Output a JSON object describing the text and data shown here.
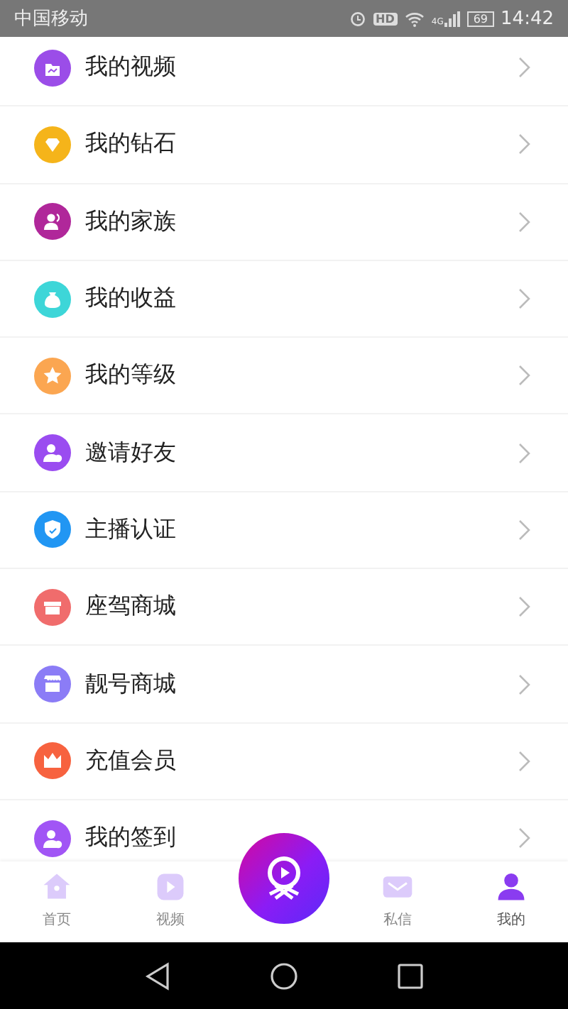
{
  "status_bar": {
    "carrier": "中国移动",
    "hd_badge": "HD",
    "network": "4G",
    "battery": "69",
    "time": "14:42"
  },
  "menu": [
    {
      "label": "我的视频",
      "kind": "video"
    },
    {
      "label": "我的钻石",
      "kind": "diamond"
    },
    {
      "label": "我的家族",
      "kind": "family"
    },
    {
      "label": "我的收益",
      "kind": "income"
    },
    {
      "label": "我的等级",
      "kind": "level"
    },
    {
      "label": "邀请好友",
      "kind": "invite"
    },
    {
      "label": "主播认证",
      "kind": "verify"
    },
    {
      "label": "座驾商城",
      "kind": "car_store"
    },
    {
      "label": "靓号商城",
      "kind": "number_store"
    },
    {
      "label": "充值会员",
      "kind": "vip"
    },
    {
      "label": "我的签到",
      "kind": "checkin"
    }
  ],
  "nav": {
    "tabs": [
      {
        "label": "首页",
        "kind": "home",
        "selected": false
      },
      {
        "label": "视频",
        "kind": "video",
        "selected": false
      },
      {
        "label": "私信",
        "kind": "message",
        "selected": false
      },
      {
        "label": "我的",
        "kind": "me",
        "selected": true
      }
    ]
  }
}
